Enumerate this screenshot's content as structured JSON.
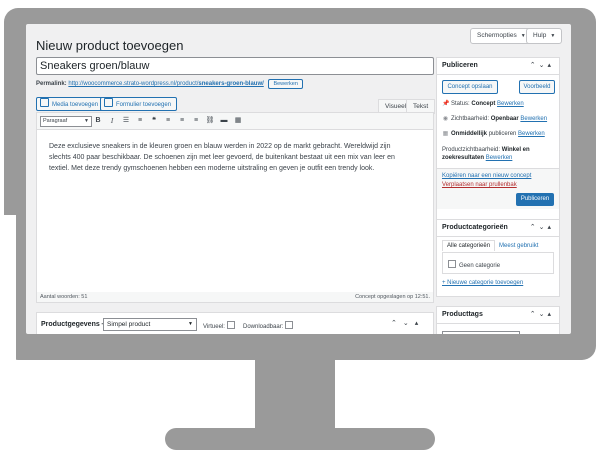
{
  "top": {
    "screen_options": "Schermopties",
    "help": "Hulp"
  },
  "page": {
    "title": "Nieuw product toevoegen"
  },
  "product": {
    "title_value": "Sneakers groen/blauw",
    "permalink_label": "Permalink:",
    "permalink_url": "http://woocommerce.strato-wordpress.nl/product/",
    "permalink_slug": "sneakers-groen-blauw/",
    "permalink_edit": "Bewerken"
  },
  "editor": {
    "media_button": "Media toevoegen",
    "form_button": "Formulier toevoegen",
    "tab_visual": "Visueel",
    "tab_text": "Tekst",
    "format_select": "Paragraaf",
    "content": "Deze exclusieve sneakers in de kleuren groen en blauw werden in 2022 op de markt gebracht. Wereldwijd zijn slechts 400 paar beschikbaar. De schoenen zijn met leer gevoerd, de buitenkant bestaat uit een mix van leer en textiel. Met deze trendy gymschoenen hebben een moderne uitstraling en geven je outfit een trendy look.",
    "word_count": "Aantal woorden: 51",
    "draft_saved": "Concept opgeslagen op 12:51."
  },
  "product_data": {
    "label": "Productgegevens —",
    "type_select": "Simpel product",
    "virtual_label": "Virtueel:",
    "downloadable_label": "Downloadbaar:"
  },
  "publish": {
    "title": "Publiceren",
    "save_draft": "Concept opslaan",
    "preview": "Voorbeeld",
    "status_label": "Status:",
    "status_value": "Concept",
    "visibility_label": "Zichtbaarheid:",
    "visibility_value": "Openbaar",
    "immediately": "Onmiddellijk",
    "publish_word": "publiceren",
    "catalog_visibility_label": "Productzichtbaarheid:",
    "catalog_visibility_value": "Winkel en zoekresultaten",
    "edit": "Bewerken",
    "copy_draft": "Kopiëren naar een nieuw concept",
    "trash": "Verplaatsen naar prullenbak",
    "publish_button": "Publiceren"
  },
  "categories": {
    "title": "Productcategorieën",
    "tab_all": "Alle categorieën",
    "tab_most_used": "Meest gebruikt",
    "item": "Geen categorie",
    "add_new": "+ Nieuwe categorie toevoegen"
  },
  "tags": {
    "title": "Producttags"
  },
  "colors": {
    "accent": "#2271b1",
    "primary_button": "#2271b1",
    "danger": "#b32d2e",
    "bezel": "#9a9a9a"
  }
}
